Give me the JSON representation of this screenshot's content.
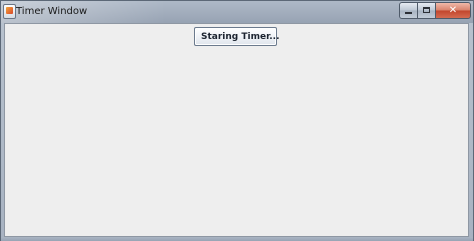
{
  "window": {
    "title": "Timer Window",
    "controls": {
      "minimize_icon": "minimize-icon",
      "maximize_icon": "maximize-icon",
      "close_glyph": "✕"
    }
  },
  "main": {
    "timer_button_label": "Staring Timer..."
  },
  "colors": {
    "client_background": "#eeeeee",
    "frame": "#a7b2c1",
    "close_button": "#c2452c"
  }
}
